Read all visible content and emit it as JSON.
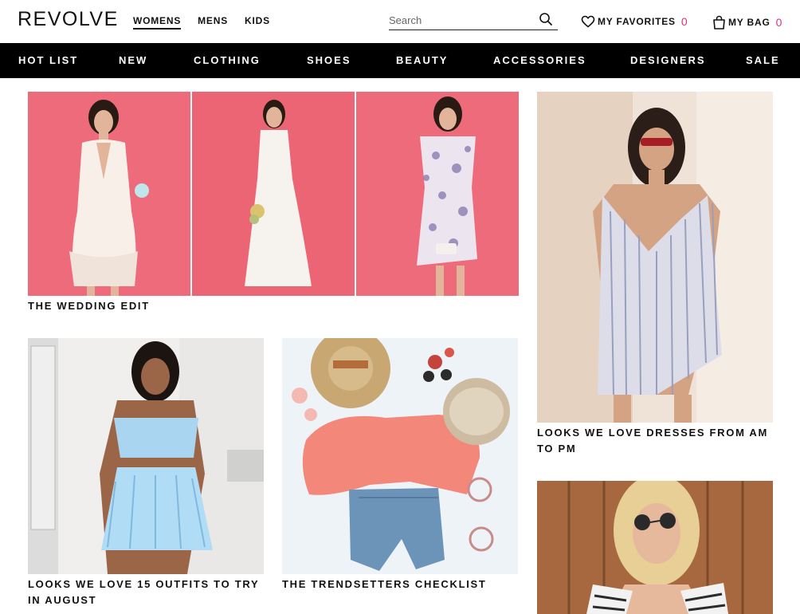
{
  "header": {
    "logo": "REVOLVE",
    "gender_tabs": [
      {
        "label": "WOMENS",
        "active": true
      },
      {
        "label": "MENS",
        "active": false
      },
      {
        "label": "KIDS",
        "active": false
      }
    ],
    "search": {
      "placeholder": "Search",
      "value": ""
    },
    "favorites": {
      "label": "MY FAVORITES",
      "count": "0",
      "icon": "heart-icon"
    },
    "bag": {
      "label": "MY BAG",
      "count": "0",
      "icon": "shopping-bag-icon"
    }
  },
  "category_nav": [
    "HOT LIST",
    "NEW",
    "CLOTHING",
    "SHOES",
    "BEAUTY",
    "ACCESSORIES",
    "DESIGNERS",
    "SALE"
  ],
  "tiles": {
    "wedding": {
      "caption": "THE WEDDING EDIT"
    },
    "dresses": {
      "caption_line1": "LOOKS WE LOVE DRESSES FROM AM",
      "caption_line2": "TO PM"
    },
    "outfits": {
      "caption_line1": "LOOKS WE LOVE 15 OUTFITS TO TRY",
      "caption_line2": "IN AUGUST"
    },
    "trendsetters": {
      "caption": "THE TRENDSETTERS CHECKLIST"
    }
  },
  "colors": {
    "accent": "#d63384",
    "nav_bg": "#000000",
    "wedding_bg": "#ee6b7b"
  }
}
